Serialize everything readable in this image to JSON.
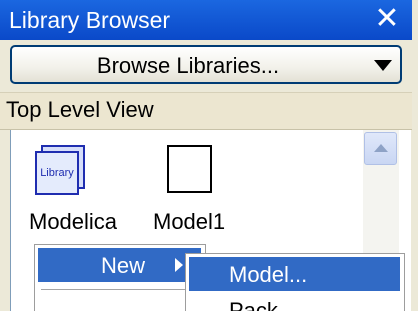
{
  "window": {
    "title": "Library Browser",
    "close_symbol": "✕"
  },
  "browse": {
    "label": "Browse Libraries...",
    "icon": "chevron-down-icon"
  },
  "view": {
    "header": "Top Level View"
  },
  "items": [
    {
      "label": "Modelica",
      "icon_text": "Library",
      "icon": "library-icon"
    },
    {
      "label": "Model1",
      "icon": "model-icon"
    }
  ],
  "context_menu": {
    "new_label": "New",
    "submenu": [
      {
        "label": "Model..."
      },
      {
        "label": "Pack"
      }
    ]
  },
  "colors": {
    "title_bar": "#0a49c9",
    "selection": "#316ac5",
    "library_stroke": "#1f2db0"
  }
}
